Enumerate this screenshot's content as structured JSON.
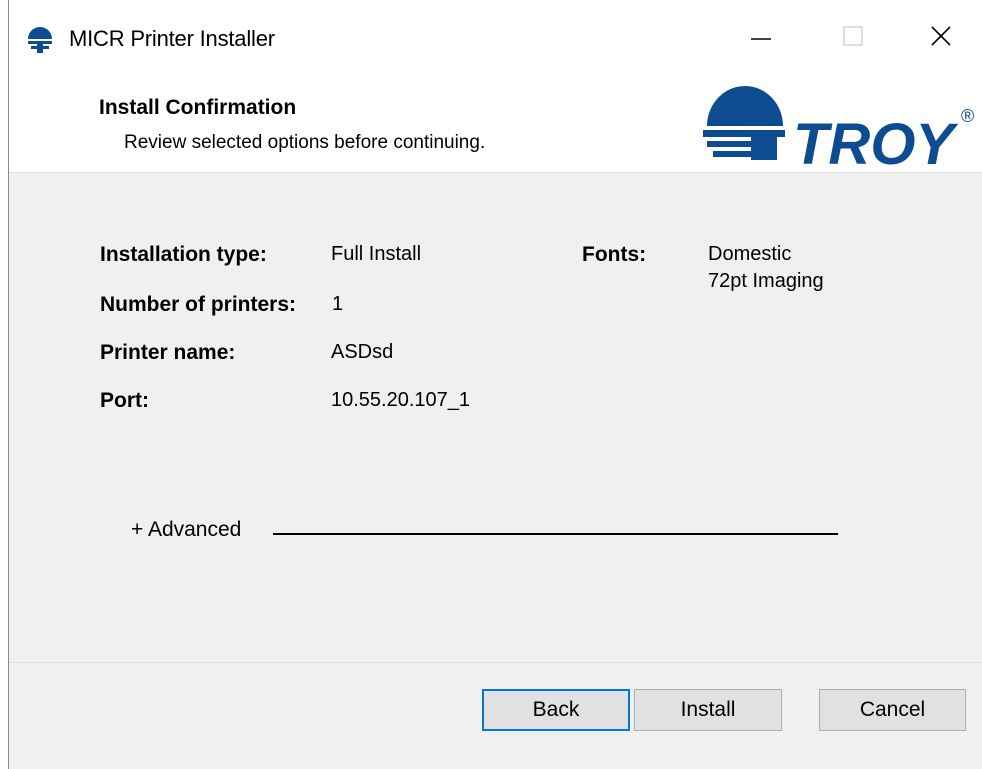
{
  "window": {
    "title": "MICR Printer Installer"
  },
  "header": {
    "title": "Install Confirmation",
    "subtitle": "Review selected options before continuing.",
    "logo_text": "TROY",
    "logo_mark": "®",
    "brand_color": "#0e4c92"
  },
  "summary": {
    "installation_type_label": "Installation type:",
    "installation_type_value": "Full Install",
    "num_printers_label": "Number of printers:",
    "num_printers_value": "1",
    "printer_name_label": "Printer name:",
    "printer_name_value": "ASDsd",
    "port_label": "Port:",
    "port_value": "10.55.20.107_1",
    "fonts_label": "Fonts:",
    "fonts_values": [
      "Domestic",
      "72pt Imaging"
    ]
  },
  "advanced": {
    "label": "+ Advanced"
  },
  "buttons": {
    "back": "Back",
    "install": "Install",
    "cancel": "Cancel"
  },
  "icons": {
    "title_icon": "troy-globe-icon",
    "minimize": "minimize-icon",
    "maximize": "maximize-icon",
    "close": "close-icon"
  },
  "colors": {
    "accent": "#0078d7",
    "window_bg": "#f0f0f0"
  }
}
